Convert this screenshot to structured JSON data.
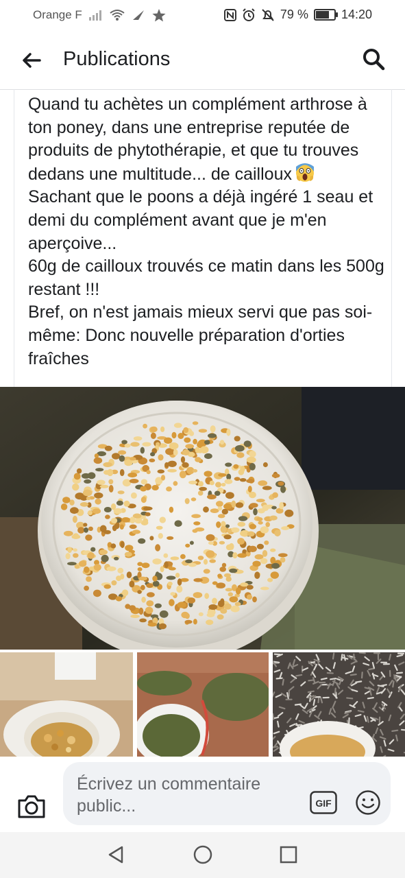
{
  "status_bar": {
    "carrier": "Orange F",
    "battery_percent": "79 %",
    "battery_level": 0.79,
    "time": "14:20"
  },
  "header": {
    "title": "Publications",
    "back_icon": "arrow-left-icon",
    "search_icon": "search-icon"
  },
  "post": {
    "text": "Quand tu achètes un complément arthrose à ton poney, dans une entreprise reputée de produits de phytothérapie, et que tu trouves dedans une multitude... de cailloux",
    "emoji": "face-screaming-in-fear",
    "text2": "Sachant que le poons a déjà ingéré 1 seau et demi du complément avant que je m'en aperçoive...\n60g de cailloux trouvés  ce matin dans les 500g restant !!!\nBref,  on n'est jamais mieux servi que pas soi-même: Donc nouvelle préparation d'orties fraîches"
  },
  "comment": {
    "placeholder": "Écrivez un commentaire public...",
    "camera_icon": "camera-icon",
    "gif_label": "GIF",
    "emoji_icon": "smiley-icon"
  },
  "nav": {
    "back_icon": "triangle-back-icon",
    "home_icon": "circle-home-icon",
    "recents_icon": "square-recents-icon"
  },
  "colors": {
    "text": "#1c1e21",
    "secondary_text": "#65676b",
    "input_bg": "#f0f2f5",
    "divider": "#dddfe2"
  }
}
